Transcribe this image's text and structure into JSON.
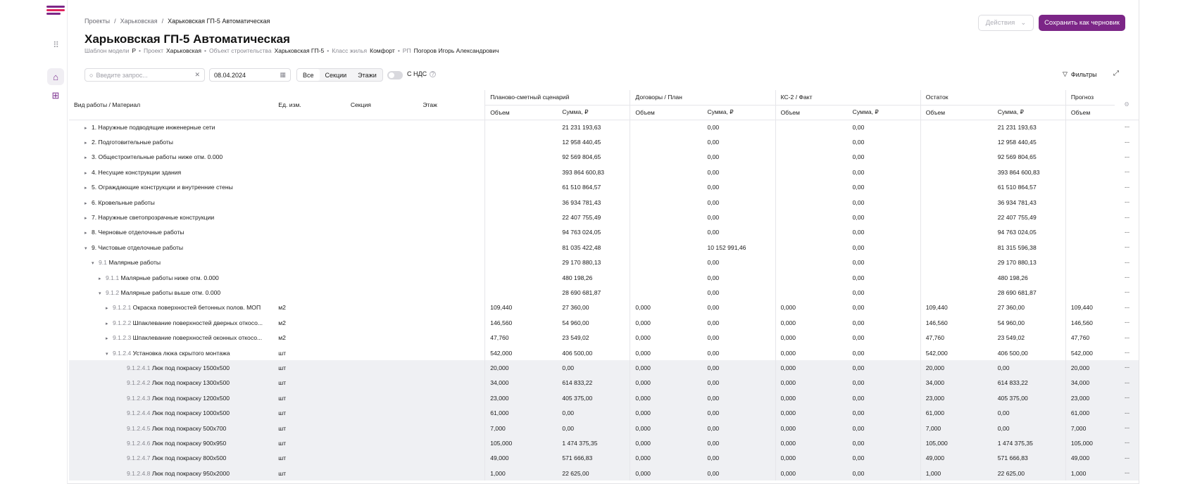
{
  "breadcrumbs": [
    "Проекты",
    "Харьковская",
    "Харьковская ГП-5 Автоматическая"
  ],
  "title": "Харьковская ГП-5 Автоматическая",
  "meta": [
    {
      "label": "Шаблон модели",
      "value": "P"
    },
    {
      "label": "Проект",
      "value": "Харьковская"
    },
    {
      "label": "Объект строительства",
      "value": "Харьковская ГП-5"
    },
    {
      "label": "Класс жилья",
      "value": "Комфорт"
    },
    {
      "label": "РП",
      "value": "Погоров Игорь Александрович"
    }
  ],
  "actions_label": "Действия",
  "save_label": "Сохранить как черновик",
  "search_placeholder": "Введите запрос...",
  "date_value": "08.04.2024",
  "segments": [
    "Все",
    "Секции",
    "Этажи"
  ],
  "vat_label": "С НДС",
  "filters_label": "Фильтры",
  "columns": {
    "work": "Вид работы / Материал",
    "unit": "Ед. изм.",
    "section": "Секция",
    "floor": "Этаж",
    "groups": [
      "Планово-сметный сценарий",
      "Договоры / План",
      "КС-2 / Факт",
      "Остаток",
      "Прогноз"
    ],
    "volume": "Объем",
    "sum": "Сумма, ₽"
  },
  "rows": [
    {
      "indent": 0,
      "tw": "▸",
      "num": "",
      "name": "1. Наружные подводящие инженерные сети",
      "unit": "",
      "v1": "",
      "s1": "21 231 193,63",
      "v2": "",
      "s2": "0,00",
      "v3": "",
      "s3": "0,00",
      "v4": "",
      "s4": "21 231 193,63",
      "v5": "",
      "gray": false
    },
    {
      "indent": 0,
      "tw": "▸",
      "num": "",
      "name": "2. Подготовительные работы",
      "unit": "",
      "v1": "",
      "s1": "12 958 440,45",
      "v2": "",
      "s2": "0,00",
      "v3": "",
      "s3": "0,00",
      "v4": "",
      "s4": "12 958 440,45",
      "v5": "",
      "gray": false
    },
    {
      "indent": 0,
      "tw": "▸",
      "num": "",
      "name": "3. Общестроительные работы ниже отм. 0.000",
      "unit": "",
      "v1": "",
      "s1": "92 569 804,65",
      "v2": "",
      "s2": "0,00",
      "v3": "",
      "s3": "0,00",
      "v4": "",
      "s4": "92 569 804,65",
      "v5": "",
      "gray": false
    },
    {
      "indent": 0,
      "tw": "▸",
      "num": "",
      "name": "4. Несущие конструкции здания",
      "unit": "",
      "v1": "",
      "s1": "393 864 600,83",
      "v2": "",
      "s2": "0,00",
      "v3": "",
      "s3": "0,00",
      "v4": "",
      "s4": "393 864 600,83",
      "v5": "",
      "gray": false
    },
    {
      "indent": 0,
      "tw": "▸",
      "num": "",
      "name": "5. Ограждающие конструкции и внутренние стены",
      "unit": "",
      "v1": "",
      "s1": "61 510 864,57",
      "v2": "",
      "s2": "0,00",
      "v3": "",
      "s3": "0,00",
      "v4": "",
      "s4": "61 510 864,57",
      "v5": "",
      "gray": false
    },
    {
      "indent": 0,
      "tw": "▸",
      "num": "",
      "name": "6. Кровельные работы",
      "unit": "",
      "v1": "",
      "s1": "36 934 781,43",
      "v2": "",
      "s2": "0,00",
      "v3": "",
      "s3": "0,00",
      "v4": "",
      "s4": "36 934 781,43",
      "v5": "",
      "gray": false
    },
    {
      "indent": 0,
      "tw": "▸",
      "num": "",
      "name": "7. Наружные светопрозрачные конструкции",
      "unit": "",
      "v1": "",
      "s1": "22 407 755,49",
      "v2": "",
      "s2": "0,00",
      "v3": "",
      "s3": "0,00",
      "v4": "",
      "s4": "22 407 755,49",
      "v5": "",
      "gray": false
    },
    {
      "indent": 0,
      "tw": "▸",
      "num": "",
      "name": "8. Черновые отделочные работы",
      "unit": "",
      "v1": "",
      "s1": "94 763 024,05",
      "v2": "",
      "s2": "0,00",
      "v3": "",
      "s3": "0,00",
      "v4": "",
      "s4": "94 763 024,05",
      "v5": "",
      "gray": false
    },
    {
      "indent": 0,
      "tw": "▾",
      "num": "",
      "name": "9. Чистовые отделочные работы",
      "unit": "",
      "v1": "",
      "s1": "81 035 422,48",
      "v2": "",
      "s2": "10 152 991,46",
      "v3": "",
      "s3": "0,00",
      "v4": "",
      "s4": "81 315 596,38",
      "v5": "",
      "gray": false
    },
    {
      "indent": 1,
      "tw": "▾",
      "num": "9.1",
      "name": "Малярные работы",
      "unit": "",
      "v1": "",
      "s1": "29 170 880,13",
      "v2": "",
      "s2": "0,00",
      "v3": "",
      "s3": "0,00",
      "v4": "",
      "s4": "29 170 880,13",
      "v5": "",
      "gray": false
    },
    {
      "indent": 2,
      "tw": "▸",
      "num": "9.1.1",
      "name": "Малярные работы ниже отм. 0.000",
      "unit": "",
      "v1": "",
      "s1": "480 198,26",
      "v2": "",
      "s2": "0,00",
      "v3": "",
      "s3": "0,00",
      "v4": "",
      "s4": "480 198,26",
      "v5": "",
      "gray": false
    },
    {
      "indent": 2,
      "tw": "▾",
      "num": "9.1.2",
      "name": "Малярные работы выше отм. 0.000",
      "unit": "",
      "v1": "",
      "s1": "28 690 681,87",
      "v2": "",
      "s2": "0,00",
      "v3": "",
      "s3": "0,00",
      "v4": "",
      "s4": "28 690 681,87",
      "v5": "",
      "gray": false
    },
    {
      "indent": 3,
      "tw": "▸",
      "num": "9.1.2.1",
      "name": "Окраска поверхностей бетонных полов. МОП",
      "unit": "м2",
      "v1": "109,440",
      "s1": "27 360,00",
      "v2": "0,000",
      "s2": "0,00",
      "v3": "0,000",
      "s3": "0,00",
      "v4": "109,440",
      "s4": "27 360,00",
      "v5": "109,440",
      "gray": false
    },
    {
      "indent": 3,
      "tw": "▸",
      "num": "9.1.2.2",
      "name": "Шпаклевание поверхностей дверных откосо...",
      "unit": "м2",
      "v1": "146,560",
      "s1": "54 960,00",
      "v2": "0,000",
      "s2": "0,00",
      "v3": "0,000",
      "s3": "0,00",
      "v4": "146,560",
      "s4": "54 960,00",
      "v5": "146,560",
      "gray": false
    },
    {
      "indent": 3,
      "tw": "▸",
      "num": "9.1.2.3",
      "name": "Шпаклевание поверхностей оконных откосо...",
      "unit": "м2",
      "v1": "47,760",
      "s1": "23 549,02",
      "v2": "0,000",
      "s2": "0,00",
      "v3": "0,000",
      "s3": "0,00",
      "v4": "47,760",
      "s4": "23 549,02",
      "v5": "47,760",
      "gray": false
    },
    {
      "indent": 3,
      "tw": "▾",
      "num": "9.1.2.4",
      "name": "Установка люка скрытого монтажа",
      "unit": "шт",
      "v1": "542,000",
      "s1": "406 500,00",
      "v2": "0,000",
      "s2": "0,00",
      "v3": "0,000",
      "s3": "0,00",
      "v4": "542,000",
      "s4": "406 500,00",
      "v5": "542,000",
      "gray": false
    },
    {
      "indent": 4,
      "tw": "",
      "num": "9.1.2.4.1",
      "name": "Люк под покраску 1500х500",
      "unit": "шт",
      "v1": "20,000",
      "s1": "0,00",
      "v2": "0,000",
      "s2": "0,00",
      "v3": "0,000",
      "s3": "0,00",
      "v4": "20,000",
      "s4": "0,00",
      "v5": "20,000",
      "gray": true
    },
    {
      "indent": 4,
      "tw": "",
      "num": "9.1.2.4.2",
      "name": "Люк под покраску 1300х500",
      "unit": "шт",
      "v1": "34,000",
      "s1": "614 833,22",
      "v2": "0,000",
      "s2": "0,00",
      "v3": "0,000",
      "s3": "0,00",
      "v4": "34,000",
      "s4": "614 833,22",
      "v5": "34,000",
      "gray": true
    },
    {
      "indent": 4,
      "tw": "",
      "num": "9.1.2.4.3",
      "name": "Люк под покраску 1200х500",
      "unit": "шт",
      "v1": "23,000",
      "s1": "405 375,00",
      "v2": "0,000",
      "s2": "0,00",
      "v3": "0,000",
      "s3": "0,00",
      "v4": "23,000",
      "s4": "405 375,00",
      "v5": "23,000",
      "gray": true
    },
    {
      "indent": 4,
      "tw": "",
      "num": "9.1.2.4.4",
      "name": "Люк под покраску 1000х500",
      "unit": "шт",
      "v1": "61,000",
      "s1": "0,00",
      "v2": "0,000",
      "s2": "0,00",
      "v3": "0,000",
      "s3": "0,00",
      "v4": "61,000",
      "s4": "0,00",
      "v5": "61,000",
      "gray": true
    },
    {
      "indent": 4,
      "tw": "",
      "num": "9.1.2.4.5",
      "name": "Люк под покраску 500х700",
      "unit": "шт",
      "v1": "7,000",
      "s1": "0,00",
      "v2": "0,000",
      "s2": "0,00",
      "v3": "0,000",
      "s3": "0,00",
      "v4": "7,000",
      "s4": "0,00",
      "v5": "7,000",
      "gray": true
    },
    {
      "indent": 4,
      "tw": "",
      "num": "9.1.2.4.6",
      "name": "Люк под покраску 900х950",
      "unit": "шт",
      "v1": "105,000",
      "s1": "1 474 375,35",
      "v2": "0,000",
      "s2": "0,00",
      "v3": "0,000",
      "s3": "0,00",
      "v4": "105,000",
      "s4": "1 474 375,35",
      "v5": "105,000",
      "gray": true
    },
    {
      "indent": 4,
      "tw": "",
      "num": "9.1.2.4.7",
      "name": "Люк под покраску 800х500",
      "unit": "шт",
      "v1": "49,000",
      "s1": "571 666,83",
      "v2": "0,000",
      "s2": "0,00",
      "v3": "0,000",
      "s3": "0,00",
      "v4": "49,000",
      "s4": "571 666,83",
      "v5": "49,000",
      "gray": true
    },
    {
      "indent": 4,
      "tw": "",
      "num": "9.1.2.4.8",
      "name": "Люк под покраску 950х2000",
      "unit": "шт",
      "v1": "1,000",
      "s1": "22 625,00",
      "v2": "0,000",
      "s2": "0,00",
      "v3": "0,000",
      "s3": "0,00",
      "v4": "1,000",
      "s4": "22 625,00",
      "v5": "1,000",
      "gray": true
    }
  ]
}
